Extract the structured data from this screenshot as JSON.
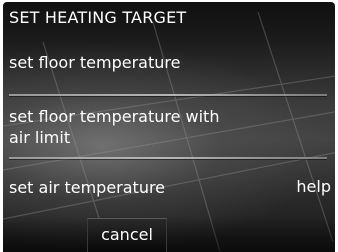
{
  "header": {
    "title": "SET HEATING TARGET"
  },
  "options": [
    {
      "label": "set floor temperature"
    },
    {
      "label_line1": "set floor temperature with",
      "label_line2": "air limit"
    },
    {
      "label": "set air temperature"
    }
  ],
  "help_label": "help",
  "cancel_label": "cancel",
  "colors": {
    "text": "#ffffff",
    "background_dark": "#1a1a1a",
    "background_mid": "#444444",
    "divider": "#b4b4b4"
  }
}
